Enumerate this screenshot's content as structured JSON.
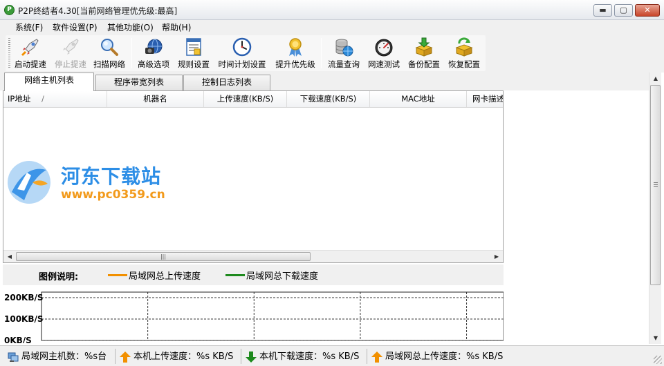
{
  "window": {
    "title": "P2P终结者4.30[当前网络管理优先级:最高]",
    "app_icon_glyph": "P",
    "controls": {
      "minimize": "▬",
      "maximize": "▢",
      "close": "✕"
    }
  },
  "menu": [
    {
      "label": "系统(F)"
    },
    {
      "label": "软件设置(P)"
    },
    {
      "label": "其他功能(O)"
    },
    {
      "label": "帮助(H)"
    }
  ],
  "toolbar": {
    "buttons": [
      {
        "label": "启动提速",
        "icon": "rocket-icon",
        "enabled": true
      },
      {
        "label": "停止提速",
        "icon": "rocket-disabled-icon",
        "enabled": false
      },
      {
        "label": "扫描网络",
        "icon": "magnifier-icon",
        "enabled": true
      },
      {
        "label": "高级选项",
        "icon": "globe-camera-icon",
        "enabled": true
      },
      {
        "label": "规则设置",
        "icon": "rules-document-icon",
        "enabled": true
      },
      {
        "label": "时间计划设置",
        "icon": "clock-icon",
        "enabled": true
      },
      {
        "label": "提升优先级",
        "icon": "ribbon-award-icon",
        "enabled": true
      },
      {
        "label": "流量查询",
        "icon": "database-globe-icon",
        "enabled": true
      },
      {
        "label": "网速测试",
        "icon": "speedometer-icon",
        "enabled": true
      },
      {
        "label": "备份配置",
        "icon": "box-download-icon",
        "enabled": true
      },
      {
        "label": "恢复配置",
        "icon": "box-restore-icon",
        "enabled": true
      }
    ]
  },
  "tabs": [
    {
      "label": "网络主机列表",
      "active": true
    },
    {
      "label": "程序带宽列表",
      "active": false
    },
    {
      "label": "控制日志列表",
      "active": false
    }
  ],
  "host_list": {
    "columns": [
      "IP地址",
      "机器名",
      "上传速度(KB/S)",
      "下载速度(KB/S)",
      "MAC地址",
      "网卡描述"
    ],
    "sort_indicator": "/",
    "scroll_thumb_label": "|||",
    "scroll_left": "◀",
    "scroll_right": "▶"
  },
  "watermark": {
    "title": "河东下载站",
    "url": "www.pc0359.cn"
  },
  "legend": {
    "title": "图例说明:",
    "items": [
      {
        "label": "局域网总上传速度",
        "color": "#f29000"
      },
      {
        "label": "局域网总下载速度",
        "color": "#1e8a1e"
      }
    ]
  },
  "chart_data": {
    "type": "line",
    "y_tick_labels": [
      "200KB/S",
      "100KB/S",
      "0KB/S"
    ],
    "series": [
      {
        "name": "局域网总上传速度",
        "values": []
      },
      {
        "name": "局域网总下载速度",
        "values": []
      }
    ],
    "grid": true
  },
  "vscroll": {
    "up": "▲",
    "down": "▼"
  },
  "status": [
    {
      "label": "局域网主机数：%s台",
      "icon": "network-hosts-icon"
    },
    {
      "label": "本机上传速度：%s KB/S",
      "icon": "upload-arrow-icon"
    },
    {
      "label": "本机下载速度：%s KB/S",
      "icon": "download-arrow-icon"
    },
    {
      "label": "局域网总上传速度：%s KB/S",
      "icon": "lan-upload-arrow-icon"
    }
  ],
  "colors": {
    "accent_orange": "#f29000",
    "accent_green": "#1e8a1e",
    "watermark_blue": "#2d8ee6",
    "watermark_orange": "#f29a1b"
  }
}
